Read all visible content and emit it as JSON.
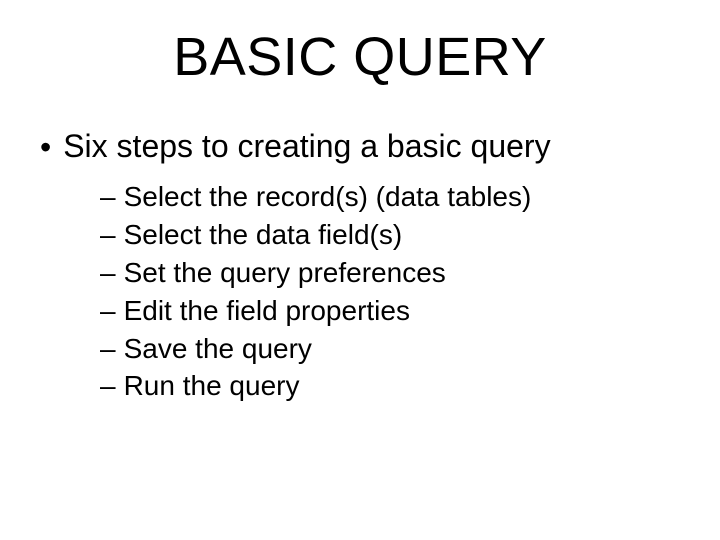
{
  "title": "BASIC QUERY",
  "main_bullet": "Six steps to creating a basic query",
  "sub_items": [
    "Select the record(s)  (data tables)",
    "Select the data field(s)",
    "Set the query preferences",
    "Edit the field properties",
    "Save the query",
    "Run the query"
  ]
}
